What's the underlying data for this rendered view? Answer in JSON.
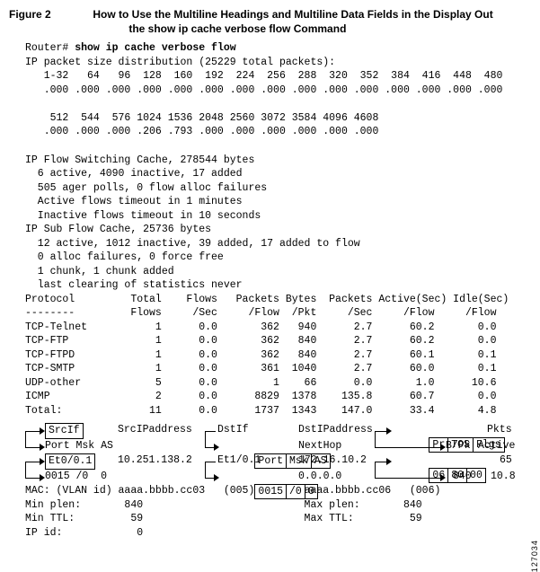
{
  "figure": {
    "label": "Figure 2",
    "title_l1": "How to Use the Multiline Headings and Multiline Data Fields in the Display Out",
    "title_l2": "the show ip cache verbose flow Command"
  },
  "prompt": "Router#",
  "command": "show ip cache verbose flow",
  "dist_header": "IP packet size distribution (25229 total packets):",
  "dist_rows": [
    "   1-32   64   96  128  160  192  224  256  288  320  352  384  416  448  480",
    "   .000 .000 .000 .000 .000 .000 .000 .000 .000 .000 .000 .000 .000 .000 .000",
    "",
    "    512  544  576 1024 1536 2048 2560 3072 3584 4096 4608",
    "   .000 .000 .000 .206 .793 .000 .000 .000 .000 .000 .000"
  ],
  "cache_lines": [
    "",
    "IP Flow Switching Cache, 278544 bytes",
    "  6 active, 4090 inactive, 17 added",
    "  505 ager polls, 0 flow alloc failures",
    "  Active flows timeout in 1 minutes",
    "  Inactive flows timeout in 10 seconds",
    "IP Sub Flow Cache, 25736 bytes",
    "  12 active, 1012 inactive, 39 added, 17 added to flow",
    "  0 alloc failures, 0 force free",
    "  1 chunk, 1 chunk added",
    "  last clearing of statistics never"
  ],
  "proto_head1": "Protocol         Total    Flows   Packets Bytes  Packets Active(Sec) Idle(Sec)",
  "proto_head2": "--------         Flows     /Sec     /Flow  /Pkt     /Sec     /Flow     /Flow",
  "proto_rows": [
    "TCP-Telnet           1      0.0       362   940      2.7      60.2       0.0",
    "TCP-FTP              1      0.0       362   840      2.7      60.2       0.0",
    "TCP-FTPD             1      0.0       362   840      2.7      60.1       0.1",
    "TCP-SMTP             1      0.0       361  1040      2.7      60.0       0.1",
    "UDP-other            5      0.0         1    66      0.0       1.0      10.6",
    "ICMP                 2      0.0      8829  1378    135.8      60.7       0.0",
    "Total:              11      0.0      1737  1343    147.0      33.4       4.8"
  ],
  "hdr": {
    "SrcIf": "SrcIf",
    "SrcIP": "SrcIPaddress",
    "DstIf": "DstIf",
    "DstIP": "DstIPaddress",
    "PortMskAS": "Port Msk AS",
    "PortMskAS_cells": [
      "Port",
      "Msk",
      "AS"
    ],
    "NextHop": "NextHop",
    "PrTOSFlgs": [
      "Pr",
      "TOS",
      "Flgs"
    ],
    "Pkts": "Pkts",
    "BPk": "B/Pk",
    "Active": "Active"
  },
  "row": {
    "SrcIf": "Et0/0.1",
    "SrcIP": "10.251.138.2",
    "DstIf": "Et1/0.1",
    "DstIP": "172.16.10.2",
    "Pr": "06",
    "TOS": "80",
    "Flgs": "00",
    "Pkts": "65",
    "SrcPort": "0015",
    "SrcMsk": "/0",
    "SrcAS": "0",
    "DstPort": "0015",
    "DstMsk": "/0",
    "DstAS": "0",
    "NextHop": "0.0.0.0",
    "BPk": "840",
    "Active": "10.8"
  },
  "trailer": [
    "MAC: (VLAN id) aaaa.bbbb.cc03   (005)        aaaa.bbbb.cc06   (006)",
    "Min plen:       840                          Max plen:       840",
    "Min TTL:         59                          Max TTL:         59",
    "IP id:            0"
  ],
  "right_id": "127034"
}
